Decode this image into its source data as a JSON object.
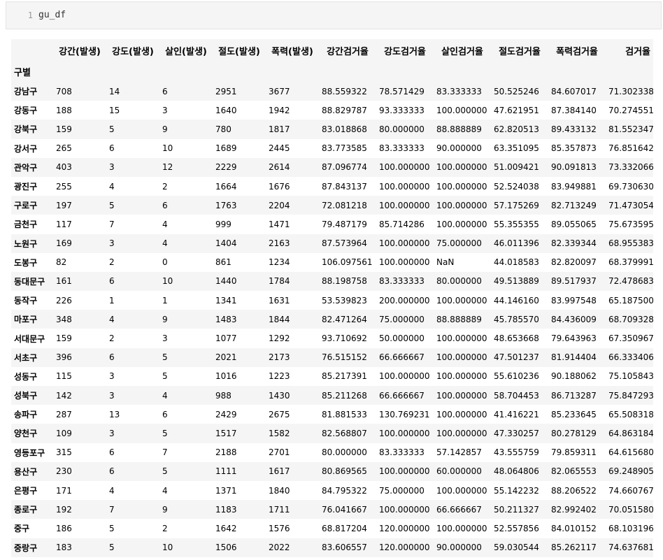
{
  "cell": {
    "line_number": "1",
    "code": "gu_df"
  },
  "table": {
    "index_name": "구별",
    "columns": [
      "강간(발생)",
      "강도(발생)",
      "살인(발생)",
      "절도(발생)",
      "폭력(발생)",
      "강간검거율",
      "강도검거율",
      "살인검거율",
      "절도검거율",
      "폭력검거율",
      "검거율"
    ],
    "rows": [
      {
        "index": "강남구",
        "values": [
          "708",
          "14",
          "6",
          "2951",
          "3677",
          "88.559322",
          "78.571429",
          "83.333333",
          "50.525246",
          "84.607017",
          "71.302338"
        ]
      },
      {
        "index": "강동구",
        "values": [
          "188",
          "15",
          "3",
          "1640",
          "1942",
          "88.829787",
          "93.333333",
          "100.000000",
          "47.621951",
          "87.384140",
          "70.274551"
        ]
      },
      {
        "index": "강북구",
        "values": [
          "159",
          "5",
          "9",
          "780",
          "1817",
          "83.018868",
          "80.000000",
          "88.888889",
          "62.820513",
          "89.433132",
          "81.552347"
        ]
      },
      {
        "index": "강서구",
        "values": [
          "265",
          "6",
          "10",
          "1689",
          "2445",
          "83.773585",
          "83.333333",
          "90.000000",
          "63.351095",
          "85.357873",
          "76.851642"
        ]
      },
      {
        "index": "관악구",
        "values": [
          "403",
          "3",
          "12",
          "2229",
          "2614",
          "87.096774",
          "100.000000",
          "100.000000",
          "51.009421",
          "90.091813",
          "73.332066"
        ]
      },
      {
        "index": "광진구",
        "values": [
          "255",
          "4",
          "2",
          "1664",
          "1676",
          "87.843137",
          "100.000000",
          "100.000000",
          "52.524038",
          "83.949881",
          "69.730630"
        ]
      },
      {
        "index": "구로구",
        "values": [
          "197",
          "5",
          "6",
          "1763",
          "2204",
          "72.081218",
          "100.000000",
          "100.000000",
          "57.175269",
          "82.713249",
          "71.473054"
        ]
      },
      {
        "index": "금천구",
        "values": [
          "117",
          "7",
          "4",
          "999",
          "1471",
          "79.487179",
          "85.714286",
          "100.000000",
          "55.355355",
          "89.055065",
          "75.673595"
        ]
      },
      {
        "index": "노원구",
        "values": [
          "169",
          "3",
          "4",
          "1404",
          "2163",
          "87.573964",
          "100.000000",
          "75.000000",
          "46.011396",
          "82.339344",
          "68.955383"
        ]
      },
      {
        "index": "도봉구",
        "values": [
          "82",
          "2",
          "0",
          "861",
          "1234",
          "106.097561",
          "100.000000",
          "NaN",
          "44.018583",
          "82.820097",
          "68.379991"
        ]
      },
      {
        "index": "동대문구",
        "values": [
          "161",
          "6",
          "10",
          "1440",
          "1784",
          "88.198758",
          "83.333333",
          "80.000000",
          "49.513889",
          "89.517937",
          "72.478683"
        ]
      },
      {
        "index": "동작구",
        "values": [
          "226",
          "1",
          "1",
          "1341",
          "1631",
          "53.539823",
          "200.000000",
          "100.000000",
          "44.146160",
          "83.997548",
          "65.187500"
        ]
      },
      {
        "index": "마포구",
        "values": [
          "348",
          "4",
          "9",
          "1483",
          "1844",
          "82.471264",
          "75.000000",
          "88.888889",
          "45.785570",
          "84.436009",
          "68.709328"
        ]
      },
      {
        "index": "서대문구",
        "values": [
          "159",
          "2",
          "3",
          "1077",
          "1292",
          "93.710692",
          "50.000000",
          "100.000000",
          "48.653668",
          "79.643963",
          "67.350967"
        ]
      },
      {
        "index": "서초구",
        "values": [
          "396",
          "6",
          "5",
          "2021",
          "2173",
          "76.515152",
          "66.666667",
          "100.000000",
          "47.501237",
          "81.914404",
          "66.333406"
        ]
      },
      {
        "index": "성동구",
        "values": [
          "115",
          "3",
          "5",
          "1016",
          "1223",
          "85.217391",
          "100.000000",
          "100.000000",
          "55.610236",
          "90.188062",
          "75.105843"
        ]
      },
      {
        "index": "성북구",
        "values": [
          "142",
          "3",
          "4",
          "988",
          "1430",
          "85.211268",
          "66.666667",
          "100.000000",
          "58.704453",
          "86.713287",
          "75.847293"
        ]
      },
      {
        "index": "송파구",
        "values": [
          "287",
          "13",
          "6",
          "2429",
          "2675",
          "81.881533",
          "130.769231",
          "100.000000",
          "41.416221",
          "85.233645",
          "65.508318"
        ]
      },
      {
        "index": "양천구",
        "values": [
          "109",
          "3",
          "5",
          "1517",
          "1582",
          "82.568807",
          "100.000000",
          "100.000000",
          "47.330257",
          "80.278129",
          "64.863184"
        ]
      },
      {
        "index": "영등포구",
        "values": [
          "315",
          "6",
          "7",
          "2188",
          "2701",
          "80.000000",
          "83.333333",
          "57.142857",
          "43.555759",
          "79.859311",
          "64.615680"
        ]
      },
      {
        "index": "용산구",
        "values": [
          "230",
          "6",
          "5",
          "1111",
          "1617",
          "80.869565",
          "100.000000",
          "60.000000",
          "48.064806",
          "82.065553",
          "69.248905"
        ]
      },
      {
        "index": "은평구",
        "values": [
          "171",
          "4",
          "4",
          "1371",
          "1840",
          "84.795322",
          "75.000000",
          "100.000000",
          "55.142232",
          "88.206522",
          "74.660767"
        ]
      },
      {
        "index": "종로구",
        "values": [
          "192",
          "7",
          "9",
          "1183",
          "1711",
          "76.041667",
          "100.000000",
          "66.666667",
          "50.211327",
          "82.992402",
          "70.051580"
        ]
      },
      {
        "index": "중구",
        "values": [
          "186",
          "5",
          "2",
          "1642",
          "1576",
          "68.817204",
          "120.000000",
          "100.000000",
          "52.557856",
          "84.010152",
          "68.103196"
        ]
      },
      {
        "index": "중랑구",
        "values": [
          "183",
          "5",
          "10",
          "1506",
          "2022",
          "83.606557",
          "120.000000",
          "90.000000",
          "59.030544",
          "85.262117",
          "74.637681"
        ]
      }
    ]
  }
}
